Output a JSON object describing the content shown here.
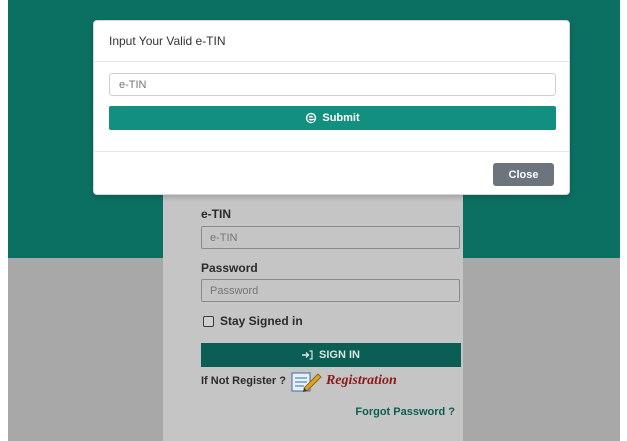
{
  "modal": {
    "title": "Input Your Valid e-TIN",
    "etin_placeholder": "e-TIN",
    "submit_label": "Submit",
    "close_label": "Close"
  },
  "login": {
    "etin_label": "e-TIN",
    "etin_placeholder": "e-TIN",
    "password_label": "Password",
    "password_placeholder": "Password",
    "stay_signed_in": "Stay Signed in",
    "signin_label": "SIGN IN",
    "not_registered": "If Not Register ?",
    "registration_link": "Registration",
    "forgot_password": "Forgot Password ?"
  },
  "colors": {
    "brand_green": "#0b7062",
    "submit_green": "#128f7e",
    "close_gray": "#6c757d",
    "registration_red": "#8a1a1a"
  }
}
